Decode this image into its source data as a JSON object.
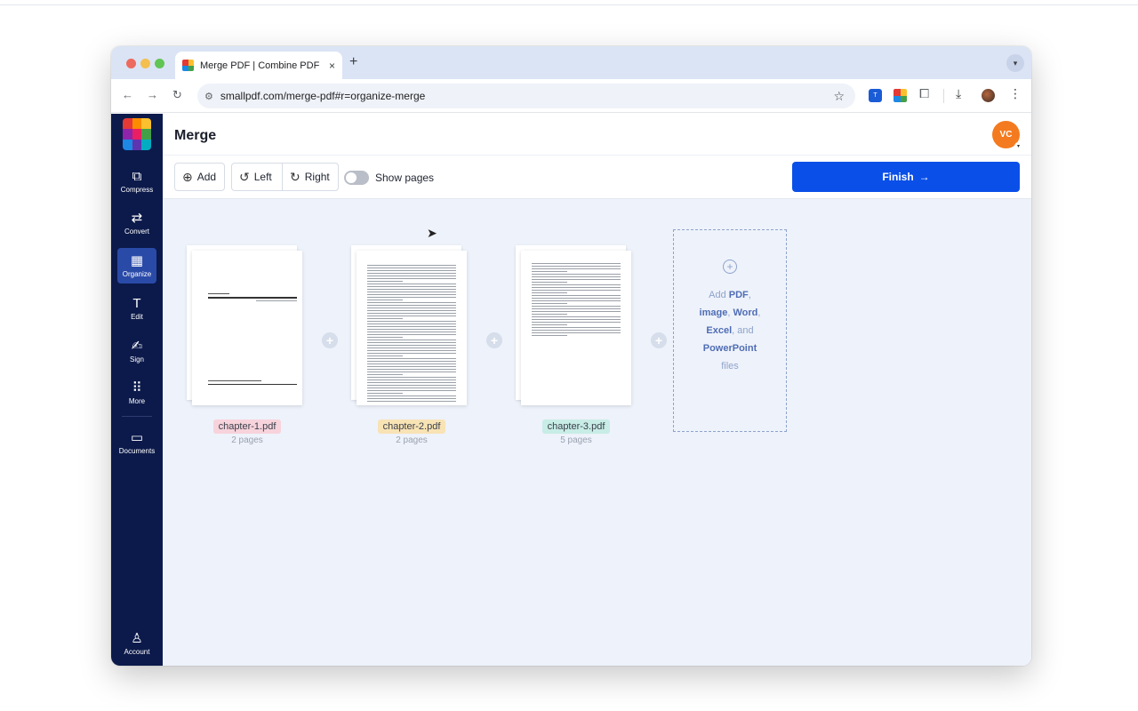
{
  "browser": {
    "tab_title": "Merge PDF | Combine PDF Fi",
    "tab_close": "×",
    "new_tab": "+",
    "url": "smallpdf.com/merge-pdf#r=organize-merge",
    "ext_tr_label": "T"
  },
  "sidebar": {
    "items": [
      {
        "label": "Compress",
        "icon": "compress-icon",
        "glyph": "⧉"
      },
      {
        "label": "Convert",
        "icon": "convert-icon",
        "glyph": "⇄"
      },
      {
        "label": "Organize",
        "icon": "organize-icon",
        "glyph": "▦",
        "active": true
      },
      {
        "label": "Edit",
        "icon": "edit-icon",
        "glyph": "T"
      },
      {
        "label": "Sign",
        "icon": "sign-icon",
        "glyph": "✍"
      },
      {
        "label": "More",
        "icon": "more-icon",
        "glyph": "⠿"
      },
      {
        "label": "Documents",
        "icon": "documents-icon",
        "glyph": "▭"
      }
    ],
    "account_label": "Account"
  },
  "header": {
    "title": "Merge",
    "avatar_initials": "VC"
  },
  "toolbar": {
    "add_label": "Add",
    "left_label": "Left",
    "right_label": "Right",
    "show_pages_label": "Show pages",
    "finish_label": "Finish",
    "finish_arrow": "→"
  },
  "files": [
    {
      "name": "chapter-1.pdf",
      "pages": "2 pages",
      "tag_color": "#f7d3dc"
    },
    {
      "name": "chapter-2.pdf",
      "pages": "2 pages",
      "tag_color": "#f8e3b5"
    },
    {
      "name": "chapter-3.pdf",
      "pages": "5 pages",
      "tag_color": "#c8ece6"
    }
  ],
  "dropzone": {
    "t1": "Add",
    "pdf": "PDF",
    "t2": ",",
    "image": "image",
    "t3": ",",
    "word": "Word",
    "t4": ",",
    "excel": "Excel",
    "t5": ", and",
    "powerpoint": "PowerPoint",
    "t6": "files"
  },
  "colors": {
    "sidebar_bg": "#0c1a4b",
    "accent_blue": "#0a4fe8",
    "avatar_bg": "#f47a1f"
  }
}
